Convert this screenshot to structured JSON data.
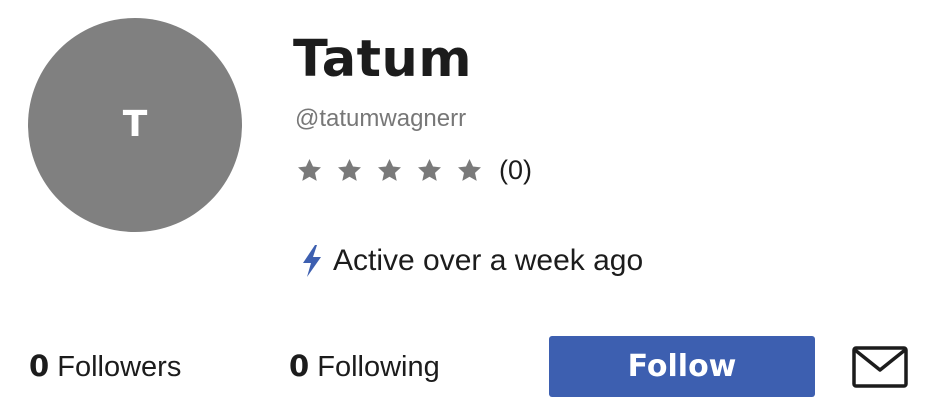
{
  "profile": {
    "avatar_initial": "T",
    "display_name": "Tatum",
    "username": "@tatumwagnerr",
    "rating": {
      "stars_total": 5,
      "stars_filled": 0,
      "count_label": "(0)",
      "star_color": "#7a7a7a"
    },
    "activity": {
      "icon": "lightning-bolt-icon",
      "icon_color": "#3d5fb0",
      "text": "Active over a week ago"
    }
  },
  "stats": {
    "followers_count": "0",
    "followers_label": "Followers",
    "following_count": "0",
    "following_label": "Following"
  },
  "actions": {
    "follow_label": "Follow",
    "follow_color": "#3d5fb0",
    "message_icon": "envelope-icon"
  }
}
